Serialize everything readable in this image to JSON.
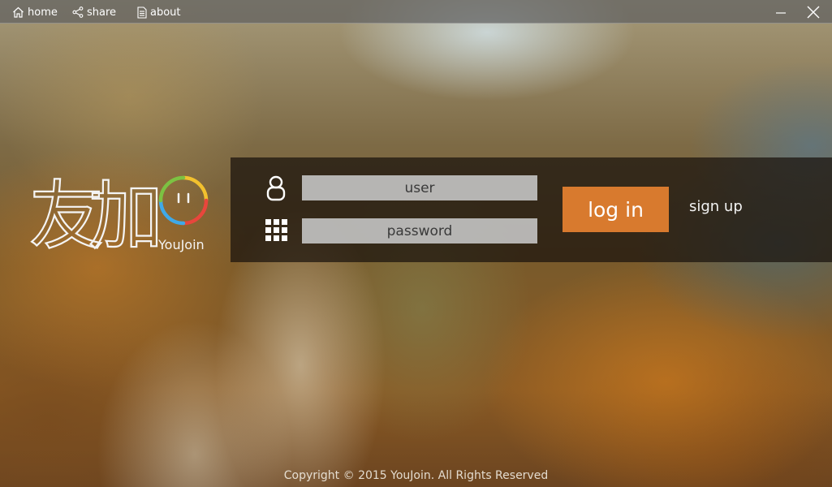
{
  "titlebar": {
    "nav": [
      {
        "label": "home",
        "icon": "home-icon"
      },
      {
        "label": "share",
        "icon": "share-icon"
      },
      {
        "label": "about",
        "icon": "document-icon"
      }
    ],
    "window_controls": [
      "minimize-icon",
      "close-icon"
    ]
  },
  "logo": {
    "chinese_text": "友加",
    "brand_text": "YouJoin",
    "ring_colors": [
      "#f2c12e",
      "#e8463c",
      "#3fa9e8",
      "#7cc242"
    ]
  },
  "login": {
    "user_placeholder": "user",
    "password_placeholder": "password",
    "user_icon": "user-icon",
    "password_icon": "keypad-icon",
    "login_label": "log in",
    "signup_label": "sign up",
    "accent_color": "#d87a2e"
  },
  "footer": {
    "copyright": "Copyright © 2015 YouJoin. All Rights Reserved"
  }
}
